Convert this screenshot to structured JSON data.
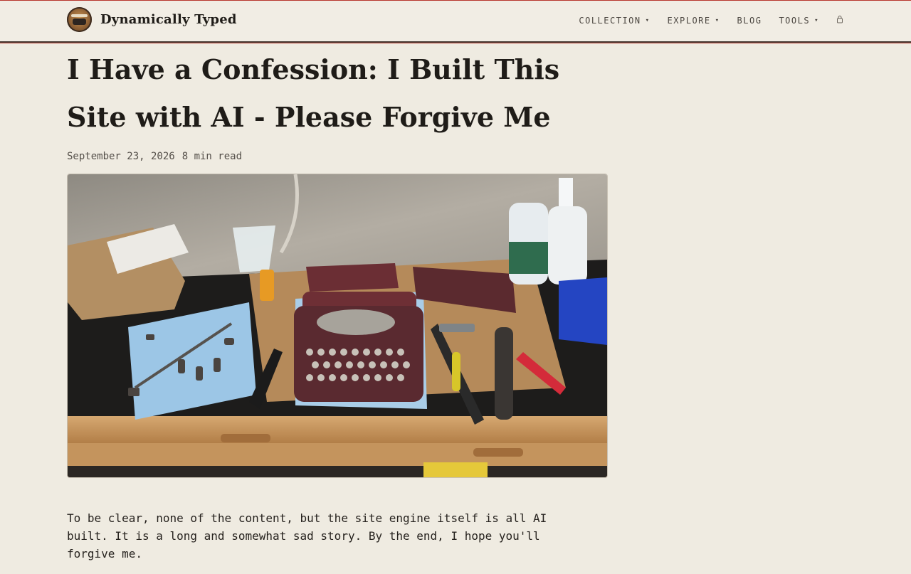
{
  "site": {
    "name": "Dynamically Typed",
    "logo": "typewriter-logo"
  },
  "nav": {
    "items": [
      {
        "label": "COLLECTION",
        "dropdown": true
      },
      {
        "label": "EXPLORE",
        "dropdown": true
      },
      {
        "label": "BLOG",
        "dropdown": false
      },
      {
        "label": "TOOLS",
        "dropdown": true
      }
    ],
    "caret": "▾",
    "lock_icon": "lock-icon"
  },
  "article": {
    "title": "I Have a Confession: I Built This Site with AI - Please Forgive Me",
    "date": "September 23, 2026",
    "read_time": "8 min read",
    "hero_image": "photo of a disassembled typewriter on a workbench with tools",
    "intro": "To be clear, none of the content, but the site engine itself is all AI built. It is a long and somewhat sad story. By the end, I hope you'll forgive me."
  },
  "colors": {
    "background": "#efebe1",
    "header_border": "#4a3e38",
    "accent_red": "#b23a2e",
    "text": "#1f1c18"
  }
}
